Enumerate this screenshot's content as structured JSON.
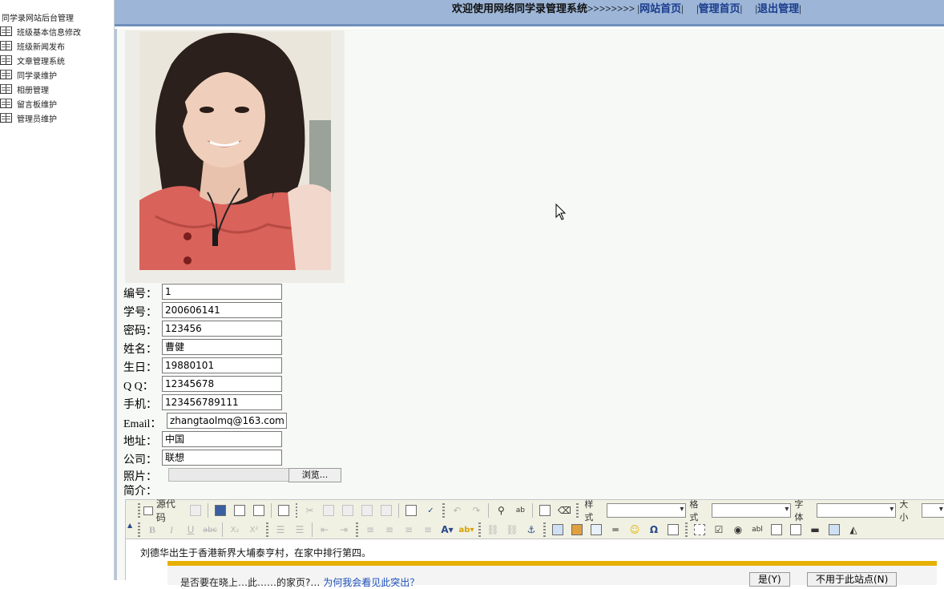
{
  "sidebar": {
    "title": "同学录网站后台管理",
    "items": [
      {
        "label": "班级基本信息修改"
      },
      {
        "label": "班级新闻发布"
      },
      {
        "label": "文章管理系统"
      },
      {
        "label": "同学录维护"
      },
      {
        "label": "相册管理"
      },
      {
        "label": "留言板维护"
      },
      {
        "label": "管理员维护"
      }
    ]
  },
  "header": {
    "welcome": "欢迎使用网络同学录管理系统>>>>>>>>",
    "links": [
      {
        "label": "网站首页"
      },
      {
        "label": "管理首页"
      },
      {
        "label": "退出管理"
      }
    ],
    "separator": "|"
  },
  "form": {
    "fields": [
      {
        "label": "编号：",
        "value": "1"
      },
      {
        "label": "学号：",
        "value": "200606141"
      },
      {
        "label": "密码：",
        "value": "123456"
      },
      {
        "label": "姓名：",
        "value": "曹健"
      },
      {
        "label": "生日：",
        "value": "19880101"
      },
      {
        "label": "Q Q：",
        "value": "12345678"
      },
      {
        "label": "手机：",
        "value": "123456789111"
      },
      {
        "label": "Email：",
        "value": "zhangtaolmq@163.com"
      },
      {
        "label": "地址：",
        "value": "中国"
      },
      {
        "label": "公司：",
        "value": "联想"
      }
    ],
    "photo_label": "照片：",
    "browse_label": "浏览...",
    "intro_label": "简介："
  },
  "editor": {
    "source_label": "源代码",
    "style_label": "样式",
    "format_label": "格式",
    "font_label": "字体",
    "size_label": "大小",
    "content": "刘德华出生于香港新界大埔泰亨村，在家中排行第四。",
    "notice": {
      "text": "是否要在晓上…此……的家页?…",
      "link": "为何我会看见此突出？",
      "yes_label": "是(Y)",
      "no_label": "不用于此站点(N)"
    }
  },
  "colors": {
    "header_bg": "#9db6d8",
    "link": "#1a3c8c",
    "notice_accent": "#e5b000"
  }
}
